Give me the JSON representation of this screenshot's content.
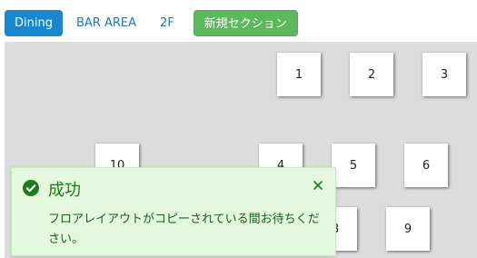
{
  "tabs": [
    {
      "label": "Dining",
      "active": true
    },
    {
      "label": "BAR AREA",
      "active": false
    },
    {
      "label": "2F",
      "active": false
    }
  ],
  "add_section_label": "新規セクション",
  "tables": [
    {
      "label": "1"
    },
    {
      "label": "2"
    },
    {
      "label": "3"
    },
    {
      "label": "10"
    },
    {
      "label": "4"
    },
    {
      "label": "5"
    },
    {
      "label": "6"
    },
    {
      "label": "8"
    },
    {
      "label": "9"
    }
  ],
  "toast": {
    "title": "成功",
    "message": "フロアレイアウトがコピーされている間お待ちください。",
    "status_color": "#1d7a1d",
    "icon": "check-circle-icon",
    "close_icon": "close-icon"
  },
  "colors": {
    "active_tab": "#1787cf",
    "add_button": "#5cb85c",
    "floor_background": "#dcdcdc",
    "toast_background": "#e4f8de"
  }
}
